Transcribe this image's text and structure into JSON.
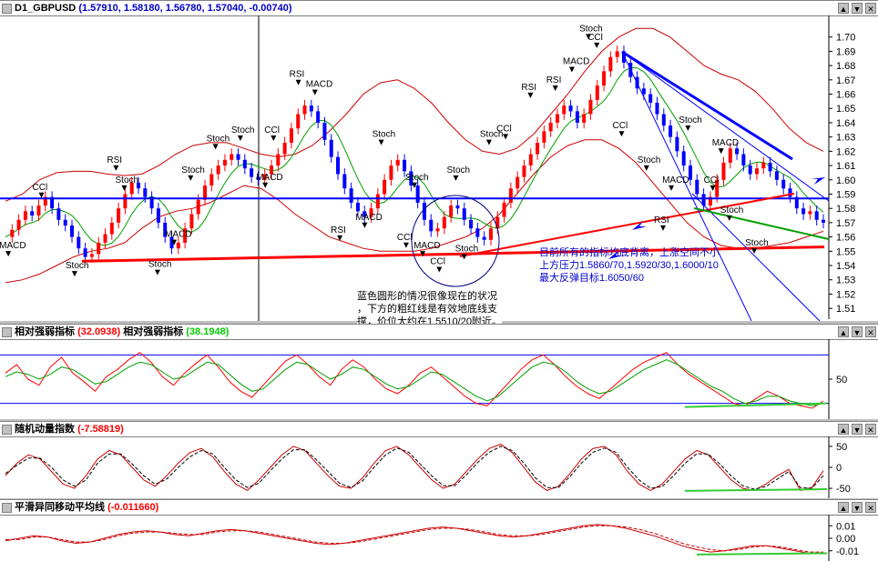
{
  "window": {
    "main_title_prefix": "D1_GBPUSD",
    "main_title_values": "(1.57910, 1.58180, 1.56780, 1.57040, -0.00740)",
    "btn_min": "▲",
    "btn_max": "▼",
    "btn_close": "✕"
  },
  "panels": {
    "rsi": {
      "title": "相对强弱指标",
      "value": "(32.0938)",
      "title2": "相对强弱指标",
      "value2": "(38.1948)"
    },
    "momentum": {
      "title": "随机动量指数",
      "value": "(-7.58819)"
    },
    "macd": {
      "title": "平滑异同移动平均线",
      "value": "(-0.011660)"
    }
  },
  "annotations": {
    "note_left": [
      "蓝色圆形的情况很像现在的状况",
      "，下方的粗红线是有效地底线支",
      "撑，价位大约在1.5510/20附近。"
    ],
    "note_right": [
      "目前所有的指标均底背离，上涨空间不小",
      "上方压力1.5860/70,1.5920/30,1.6000/10",
      "最大反弹目标1.6050/60"
    ]
  },
  "colors": {
    "up_candle": "#ff0000",
    "down_candle": "#0000ff",
    "band": "#cc0000",
    "ma_green": "#00a000",
    "trend_red": "#ff0000",
    "trend_blue": "#0000ff",
    "divergence_green": "#33cc33"
  },
  "chart_data": [
    {
      "type": "candlestick",
      "title": "D1_GBPUSD",
      "ylim": [
        1.505,
        1.71
      ],
      "y_ticks": [
        "1.70",
        "1.69",
        "1.68",
        "1.67",
        "1.66",
        "1.65",
        "1.64",
        "1.63",
        "1.62",
        "1.61",
        "1.60",
        "1.59",
        "1.58",
        "1.57",
        "1.56",
        "1.55",
        "1.54",
        "1.53",
        "1.52",
        "1.51"
      ],
      "y_tick_values": [
        1.7,
        1.69,
        1.68,
        1.67,
        1.66,
        1.65,
        1.64,
        1.63,
        1.62,
        1.61,
        1.6,
        1.59,
        1.58,
        1.57,
        1.56,
        1.55,
        1.54,
        1.53,
        1.52,
        1.51
      ],
      "close_series": [
        1.56,
        1.565,
        1.572,
        1.578,
        1.575,
        1.582,
        1.588,
        1.58,
        1.572,
        1.568,
        1.56,
        1.552,
        1.546,
        1.548,
        1.556,
        1.562,
        1.57,
        1.58,
        1.59,
        1.598,
        1.594,
        1.588,
        1.58,
        1.57,
        1.56,
        1.552,
        1.556,
        1.566,
        1.576,
        1.586,
        1.596,
        1.604,
        1.61,
        1.614,
        1.618,
        1.614,
        1.608,
        1.602,
        1.6,
        1.604,
        1.61,
        1.618,
        1.626,
        1.636,
        1.646,
        1.652,
        1.648,
        1.64,
        1.628,
        1.616,
        1.604,
        1.594,
        1.584,
        1.578,
        1.574,
        1.58,
        1.59,
        1.6,
        1.61,
        1.614,
        1.606,
        1.596,
        1.584,
        1.572,
        1.564,
        1.566,
        1.574,
        1.582,
        1.58,
        1.572,
        1.566,
        1.56,
        1.558,
        1.566,
        1.574,
        1.584,
        1.594,
        1.602,
        1.61,
        1.618,
        1.626,
        1.634,
        1.64,
        1.646,
        1.652,
        1.648,
        1.64,
        1.646,
        1.656,
        1.666,
        1.676,
        1.686,
        1.69,
        1.682,
        1.672,
        1.664,
        1.66,
        1.654,
        1.646,
        1.638,
        1.63,
        1.62,
        1.61,
        1.6,
        1.59,
        1.582,
        1.588,
        1.6,
        1.612,
        1.622,
        1.618,
        1.61,
        1.604,
        1.608,
        1.612,
        1.606,
        1.6,
        1.594,
        1.588,
        1.58,
        1.576,
        1.578,
        1.572,
        1.57
      ],
      "band_upper": [
        1.585,
        1.59,
        1.6,
        1.605,
        1.606,
        1.606,
        1.604,
        1.603,
        1.604,
        1.61,
        1.618,
        1.624,
        1.626,
        1.626,
        1.622,
        1.618,
        1.616,
        1.618,
        1.624,
        1.634,
        1.646,
        1.66,
        1.668,
        1.67,
        1.664,
        1.654,
        1.64,
        1.628,
        1.62,
        1.618,
        1.622,
        1.632,
        1.646,
        1.66,
        1.676,
        1.69,
        1.7,
        1.706,
        1.706,
        1.7,
        1.69,
        1.68,
        1.674,
        1.67,
        1.662,
        1.65,
        1.636,
        1.626,
        1.62
      ],
      "band_lower": [
        1.528,
        1.53,
        1.534,
        1.54,
        1.546,
        1.55,
        1.552,
        1.556,
        1.566,
        1.574,
        1.578,
        1.58,
        1.584,
        1.59,
        1.596,
        1.594,
        1.586,
        1.576,
        1.568,
        1.56,
        1.556,
        1.552,
        1.55,
        1.55,
        1.55,
        1.552,
        1.556,
        1.56,
        1.566,
        1.576,
        1.59,
        1.604,
        1.616,
        1.624,
        1.628,
        1.628,
        1.622,
        1.612,
        1.598,
        1.584,
        1.57,
        1.56,
        1.554,
        1.552,
        1.552,
        1.554,
        1.556,
        1.56,
        1.564
      ],
      "horizontal_line": 1.587,
      "support_line": [
        1.543,
        1.553
      ],
      "signals": [
        {
          "label": "MACD",
          "pos": 0.01,
          "price": 1.552
        },
        {
          "label": "Stoch",
          "pos": 0.09,
          "price": 1.538
        },
        {
          "label": "CCl",
          "pos": 0.05,
          "price": 1.593
        },
        {
          "label": "Stoch",
          "pos": 0.15,
          "price": 1.598
        },
        {
          "label": "RSI",
          "pos": 0.14,
          "price": 1.612
        },
        {
          "label": "Stoch",
          "pos": 0.19,
          "price": 1.539
        },
        {
          "label": "MACD",
          "pos": 0.21,
          "price": 1.56
        },
        {
          "label": "Stoch",
          "pos": 0.23,
          "price": 1.605
        },
        {
          "label": "Stoch",
          "pos": 0.26,
          "price": 1.627
        },
        {
          "label": "Stoch",
          "pos": 0.29,
          "price": 1.633
        },
        {
          "label": "MACD",
          "pos": 0.32,
          "price": 1.6
        },
        {
          "label": "CCl",
          "pos": 0.33,
          "price": 1.633
        },
        {
          "label": "RSI",
          "pos": 0.36,
          "price": 1.672
        },
        {
          "label": "MACD",
          "pos": 0.38,
          "price": 1.665
        },
        {
          "label": "RSI",
          "pos": 0.41,
          "price": 1.563
        },
        {
          "label": "MACD",
          "pos": 0.44,
          "price": 1.572
        },
        {
          "label": "Stoch",
          "pos": 0.46,
          "price": 1.63
        },
        {
          "label": "Stoch",
          "pos": 0.5,
          "price": 1.6
        },
        {
          "label": "CCl",
          "pos": 0.49,
          "price": 1.558
        },
        {
          "label": "MACD",
          "pos": 0.51,
          "price": 1.552
        },
        {
          "label": "Stoch",
          "pos": 0.55,
          "price": 1.605
        },
        {
          "label": "Stoch",
          "pos": 0.56,
          "price": 1.55
        },
        {
          "label": "CCl",
          "pos": 0.53,
          "price": 1.541
        },
        {
          "label": "Stoch",
          "pos": 0.59,
          "price": 1.63
        },
        {
          "label": "CCl",
          "pos": 0.61,
          "price": 1.634
        },
        {
          "label": "RSI",
          "pos": 0.64,
          "price": 1.663
        },
        {
          "label": "RSI",
          "pos": 0.67,
          "price": 1.668
        },
        {
          "label": "MACD",
          "pos": 0.69,
          "price": 1.681
        },
        {
          "label": "Stoch",
          "pos": 0.71,
          "price": 1.704
        },
        {
          "label": "CCl",
          "pos": 0.72,
          "price": 1.698
        },
        {
          "label": "CCl",
          "pos": 0.75,
          "price": 1.636
        },
        {
          "label": "Stoch",
          "pos": 0.78,
          "price": 1.612
        },
        {
          "label": "MACD",
          "pos": 0.81,
          "price": 1.598
        },
        {
          "label": "RSI",
          "pos": 0.8,
          "price": 1.57
        },
        {
          "label": "Stoch",
          "pos": 0.83,
          "price": 1.64
        },
        {
          "label": "MACD",
          "pos": 0.87,
          "price": 1.624
        },
        {
          "label": "CCl",
          "pos": 0.86,
          "price": 1.598
        },
        {
          "label": "Stoch",
          "pos": 0.88,
          "price": 1.577
        },
        {
          "label": "Stoch",
          "pos": 0.91,
          "price": 1.554
        }
      ]
    },
    {
      "type": "line",
      "title": "相对强弱指标",
      "ylim": [
        20,
        80
      ],
      "y_ticks": [
        "50"
      ],
      "y_tick_values": [
        50
      ],
      "levels": [
        70,
        30
      ],
      "series": [
        {
          "name": "相对强弱指标 (32.0938)",
          "values": [
            55,
            62,
            50,
            45,
            60,
            68,
            55,
            48,
            40,
            52,
            58,
            66,
            72,
            64,
            52,
            45,
            55,
            63,
            70,
            60,
            48,
            40,
            35,
            45,
            55,
            65,
            70,
            62,
            52,
            45,
            58,
            66,
            60,
            50,
            42,
            38,
            45,
            55,
            60,
            52,
            44,
            36,
            30,
            28,
            38,
            48,
            58,
            66,
            70,
            62,
            52,
            44,
            38,
            34,
            42,
            50,
            58,
            64,
            68,
            72,
            62,
            54,
            48,
            42,
            36,
            30,
            28,
            34,
            40,
            36,
            30,
            28,
            26,
            32
          ]
        },
        {
          "name": "相对强弱指标 (38.1948)",
          "values": [
            52,
            56,
            54,
            50,
            54,
            60,
            58,
            52,
            46,
            48,
            54,
            60,
            64,
            62,
            56,
            50,
            52,
            58,
            64,
            62,
            54,
            46,
            40,
            42,
            50,
            58,
            64,
            62,
            56,
            50,
            54,
            60,
            58,
            52,
            46,
            42,
            44,
            50,
            56,
            54,
            48,
            42,
            36,
            32,
            36,
            44,
            52,
            60,
            64,
            62,
            56,
            48,
            42,
            38,
            40,
            46,
            52,
            58,
            62,
            66,
            62,
            56,
            50,
            44,
            40,
            34,
            30,
            32,
            36,
            36,
            32,
            30,
            28,
            30
          ]
        }
      ],
      "divergence_line": [
        27,
        30
      ]
    },
    {
      "type": "line",
      "title": "随机动量指数",
      "ylim": [
        -65,
        65
      ],
      "y_ticks": [
        "50",
        "0",
        "-50"
      ],
      "y_tick_values": [
        50,
        0,
        -50
      ],
      "series": [
        {
          "name": "随机动量指数 (-7.58819)",
          "values": [
            -20,
            10,
            30,
            20,
            -10,
            -40,
            -50,
            -20,
            20,
            40,
            30,
            0,
            -30,
            -45,
            -20,
            10,
            35,
            45,
            25,
            -10,
            -40,
            -55,
            -30,
            0,
            30,
            50,
            40,
            10,
            -20,
            -45,
            -50,
            -25,
            10,
            40,
            50,
            30,
            0,
            -30,
            -50,
            -40,
            -10,
            20,
            45,
            55,
            35,
            0,
            -35,
            -55,
            -45,
            -15,
            20,
            45,
            50,
            30,
            -10,
            -40,
            -55,
            -40,
            -10,
            20,
            40,
            30,
            0,
            -30,
            -50,
            -55,
            -40,
            -20,
            -5,
            -55,
            -48,
            -8
          ]
        },
        {
          "name": "信号线",
          "values": [
            -15,
            5,
            22,
            22,
            0,
            -30,
            -45,
            -30,
            10,
            32,
            32,
            8,
            -20,
            -40,
            -28,
            0,
            25,
            40,
            32,
            0,
            -30,
            -48,
            -38,
            -8,
            20,
            42,
            42,
            18,
            -10,
            -38,
            -48,
            -32,
            0,
            30,
            46,
            36,
            8,
            -20,
            -44,
            -44,
            -18,
            12,
            36,
            50,
            40,
            10,
            -25,
            -48,
            -48,
            -22,
            10,
            36,
            46,
            36,
            0,
            -30,
            -50,
            -46,
            -20,
            10,
            32,
            32,
            8,
            -20,
            -44,
            -52,
            -46,
            -28,
            -10,
            -48,
            -50,
            -20
          ]
        }
      ],
      "divergence_line": [
        -56,
        -52
      ]
    },
    {
      "type": "line",
      "title": "平滑异同移动平均线",
      "ylim": [
        -0.016,
        0.016
      ],
      "y_ticks": [
        "0.01",
        "0.00",
        "-0.01"
      ],
      "y_tick_values": [
        0.01,
        0.0,
        -0.01
      ],
      "series": [
        {
          "name": "平滑异同移动平均线 (-0.011660)",
          "values": [
            -0.002,
            0.0,
            0.002,
            0.001,
            -0.002,
            -0.004,
            -0.003,
            0.0,
            0.003,
            0.005,
            0.006,
            0.005,
            0.003,
            0.002,
            0.004,
            0.006,
            0.007,
            0.006,
            0.004,
            0.002,
            0.0,
            -0.002,
            -0.004,
            -0.005,
            -0.004,
            -0.002,
            0.0,
            0.002,
            0.004,
            0.006,
            0.008,
            0.009,
            0.008,
            0.006,
            0.004,
            0.002,
            0.001,
            0.002,
            0.004,
            0.006,
            0.008,
            0.01,
            0.011,
            0.01,
            0.008,
            0.005,
            0.002,
            -0.002,
            -0.006,
            -0.009,
            -0.011,
            -0.01,
            -0.008,
            -0.006,
            -0.006,
            -0.008,
            -0.01,
            -0.012,
            -0.0117
          ]
        },
        {
          "name": "信号线",
          "values": [
            -0.001,
            -0.001,
            0.001,
            0.001,
            -0.001,
            -0.003,
            -0.003,
            -0.001,
            0.002,
            0.004,
            0.005,
            0.005,
            0.004,
            0.003,
            0.003,
            0.005,
            0.006,
            0.006,
            0.005,
            0.003,
            0.001,
            -0.001,
            -0.003,
            -0.004,
            -0.004,
            -0.003,
            -0.001,
            0.001,
            0.003,
            0.005,
            0.007,
            0.008,
            0.008,
            0.007,
            0.005,
            0.003,
            0.002,
            0.002,
            0.003,
            0.005,
            0.007,
            0.009,
            0.01,
            0.01,
            0.009,
            0.007,
            0.004,
            0.0,
            -0.004,
            -0.007,
            -0.009,
            -0.01,
            -0.009,
            -0.007,
            -0.006,
            -0.007,
            -0.009,
            -0.011,
            -0.011
          ]
        }
      ],
      "divergence_line": [
        -0.013,
        -0.012
      ]
    }
  ]
}
